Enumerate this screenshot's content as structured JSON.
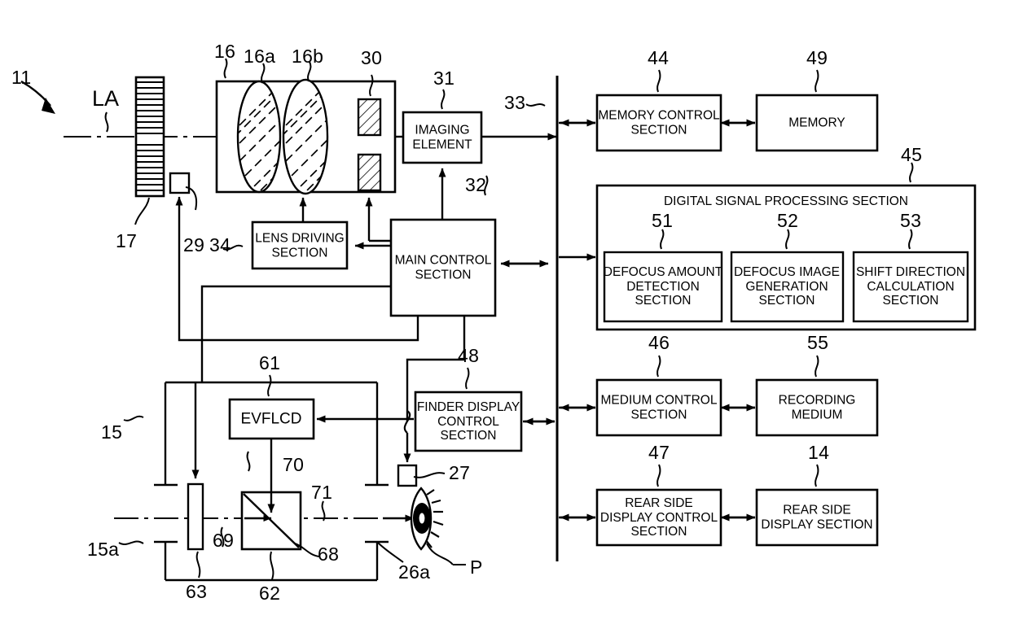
{
  "figure": {
    "type": "patent-block-diagram",
    "title": "Digital camera block diagram"
  },
  "blocks": {
    "imaging_element": "IMAGING\nELEMENT",
    "imaging_element_l1": "IMAGING",
    "imaging_element_l2": "ELEMENT",
    "lens_driving_l1": "LENS DRIVING",
    "lens_driving_l2": "SECTION",
    "main_control_l1": "MAIN CONTROL",
    "main_control_l2": "SECTION",
    "memory_control_l1": "MEMORY CONTROL",
    "memory_control_l2": "SECTION",
    "memory": "MEMORY",
    "dsp_title": "DIGITAL SIGNAL PROCESSING SECTION",
    "defocus_amount_l1": "DEFOCUS AMOUNT",
    "defocus_amount_l2": "DETECTION",
    "defocus_amount_l3": "SECTION",
    "defocus_image_l1": "DEFOCUS IMAGE",
    "defocus_image_l2": "GENERATION",
    "defocus_image_l3": "SECTION",
    "shift_direction_l1": "SHIFT DIRECTION",
    "shift_direction_l2": "CALCULATION",
    "shift_direction_l3": "SECTION",
    "medium_control_l1": "MEDIUM CONTROL",
    "medium_control_l2": "SECTION",
    "recording_medium_l1": "RECORDING",
    "recording_medium_l2": "MEDIUM",
    "rear_display_control_l1": "REAR SIDE",
    "rear_display_control_l2": "DISPLAY CONTROL",
    "rear_display_control_l3": "SECTION",
    "rear_display_section_l1": "REAR SIDE",
    "rear_display_section_l2": "DISPLAY SECTION",
    "finder_display_l1": "FINDER DISPLAY",
    "finder_display_l2": "CONTROL",
    "finder_display_l3": "SECTION",
    "evf_lcd": "EVFLCD"
  },
  "refnums": {
    "n11": "11",
    "la": "LA",
    "n17": "17",
    "n29": "29",
    "n16": "16",
    "n16a": "16a",
    "n16b": "16b",
    "n30": "30",
    "n31": "31",
    "n32": "32",
    "n33": "33",
    "n34": "34",
    "n44": "44",
    "n49": "49",
    "n45": "45",
    "n51": "51",
    "n52": "52",
    "n53": "53",
    "n46": "46",
    "n55": "55",
    "n47": "47",
    "n14": "14",
    "n48": "48",
    "n61": "61",
    "n70": "70",
    "n71": "71",
    "n68": "68",
    "n69": "69",
    "n63": "63",
    "n62": "62",
    "n27": "27",
    "n26a": "26a",
    "n15": "15",
    "n15a": "15a",
    "p": "P"
  },
  "colors": {
    "stroke": "#000000",
    "background": "#ffffff"
  }
}
